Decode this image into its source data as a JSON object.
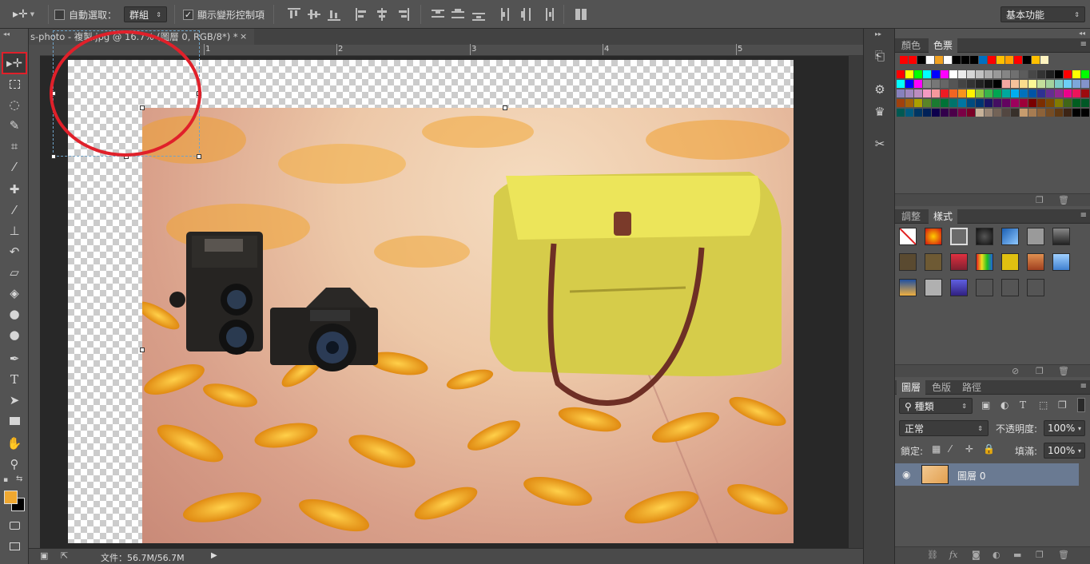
{
  "options_bar": {
    "auto_select_label": "自動選取：",
    "auto_select_checked": false,
    "auto_select_target": "群組",
    "show_transform_label": "顯示變形控制項",
    "show_transform_checked": true,
    "workspace": "基本功能"
  },
  "document": {
    "tab_title": "s-photo - 複製.jpg @ 16.7% (圖層 0, RGB/8*) *",
    "ruler_labels": [
      "1",
      "2",
      "3",
      "4",
      "5"
    ],
    "status": "文件：56.7M/56.7M"
  },
  "swatches_panel": {
    "tabs": [
      "顏色",
      "色票"
    ],
    "active_tab": "色票",
    "recent": [
      "#ff0000",
      "#ff0000",
      "#000000",
      "#ffffff",
      "#f0a020",
      "#ffffff",
      "#000000",
      "#000000",
      "#000000",
      "#0070c0",
      "#ff0000",
      "#ffc000",
      "#ffa000",
      "#ff0000",
      "#000000",
      "#ffc000",
      "#fff3c0"
    ],
    "rows": [
      [
        "#ff0000",
        "#ffff00",
        "#00ff00",
        "#00ffff",
        "#0000ff",
        "#ff00ff",
        "#ffffff",
        "#ebebeb",
        "#d6d6d6",
        "#c2c2c2",
        "#adadad",
        "#999999",
        "#858585",
        "#707070",
        "#5c5c5c",
        "#474747",
        "#333333",
        "#1f1f1f",
        "#000000",
        "#ff0000",
        "#ffff00",
        "#00ff00"
      ],
      [
        "#00ffff",
        "#0000ff",
        "#ff00ff",
        "#888888",
        "#777777",
        "#666666",
        "#555555",
        "#444444",
        "#333333",
        "#222222",
        "#111111",
        "#000000",
        "#f4a7a0",
        "#f6c19a",
        "#fbdc8c",
        "#fdf895",
        "#c4df9b",
        "#a3d39c",
        "#7bcdc8",
        "#6dcff6",
        "#7da7d9",
        "#8393ca"
      ],
      [
        "#8781bd",
        "#a187be",
        "#bc8dbf",
        "#f49ac2",
        "#f5989d",
        "#ed1c24",
        "#f26522",
        "#f7941d",
        "#fff200",
        "#8dc63f",
        "#39b54a",
        "#00a651",
        "#00a99d",
        "#00aeef",
        "#0072bc",
        "#0054a6",
        "#2e3192",
        "#662d91",
        "#92278f",
        "#ec008c",
        "#ed145b",
        "#9e0b0f"
      ],
      [
        "#a0410d",
        "#a36209",
        "#aba000",
        "#598527",
        "#1a7b30",
        "#007236",
        "#00746b",
        "#0076a3",
        "#004b80",
        "#003471",
        "#1b1464",
        "#440e62",
        "#630460",
        "#9e005d",
        "#9e0039",
        "#790000",
        "#7b2e00",
        "#7d4900",
        "#827b00",
        "#406618",
        "#005e20",
        "#005826"
      ],
      [
        "#005952",
        "#005b7f",
        "#003663",
        "#002157",
        "#0d004c",
        "#32004b",
        "#4b0049",
        "#7b0046",
        "#7a0026",
        "#c7b299",
        "#998675",
        "#736357",
        "#534741",
        "#37302a",
        "#c69c6e",
        "#a67c52",
        "#8c6239",
        "#754c24",
        "#603913",
        "#3c2415",
        "#000000",
        "#000000"
      ]
    ]
  },
  "styles_panel": {
    "tabs": [
      "調整",
      "樣式"
    ],
    "active_tab": "樣式"
  },
  "layers_panel": {
    "tabs": [
      "圖層",
      "色版",
      "路徑"
    ],
    "active_tab": "圖層",
    "filter_kind": "種類",
    "blend_mode": "正常",
    "opacity_label": "不透明度:",
    "opacity_value": "100%",
    "lock_label": "鎖定:",
    "fill_label": "填滿:",
    "fill_value": "100%",
    "layers": [
      {
        "name": "圖層 0",
        "visible": true,
        "selected": true
      }
    ]
  },
  "colors": {
    "foreground": "#f0a830",
    "background": "#000000",
    "highlight_red": "#e0202a"
  }
}
